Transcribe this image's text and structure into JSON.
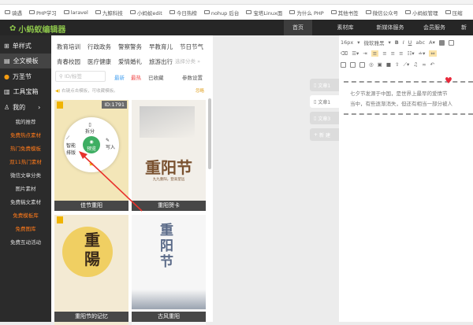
{
  "bookmarks": [
    "骑遇",
    "PHP学习",
    "laravel",
    "九鲸科技",
    "小蚂蚁edit",
    "今日热榜",
    "nohup 后台",
    "宝塔Linux面",
    "为什么 PHP",
    "其他书签",
    "微信公众号",
    "小蚂蚁管理",
    "压缩"
  ],
  "header": {
    "logo": "小蚂蚁编辑器",
    "nav": [
      "首页",
      "素材库",
      "新媒体服务",
      "会员服务",
      "新"
    ]
  },
  "sidebar": {
    "items": [
      "单样式",
      "全文模板",
      "万圣节",
      "工具宝箱",
      "我的"
    ],
    "sub": [
      {
        "label": "我的推荐",
        "color": "#dddddd"
      },
      {
        "label": "免费热点素材",
        "color": "#ff7a1a"
      },
      {
        "label": "热门免费模板",
        "color": "#ff7a1a"
      },
      {
        "label": "双11热门素材",
        "color": "#ff7a1a"
      },
      {
        "label": "微信文章分类",
        "color": "#dddddd"
      },
      {
        "label": "图片素材",
        "color": "#dddddd"
      },
      {
        "label": "免费稿文素材",
        "color": "#dddddd"
      },
      {
        "label": "免费模板库",
        "color": "#ff7a1a"
      },
      {
        "label": "免费图库",
        "color": "#ff7a1a"
      },
      {
        "label": "免费互动活动",
        "color": "#dddddd"
      }
    ]
  },
  "categories": {
    "row1": [
      "教育培训",
      "行政政务",
      "警察警务",
      "早教育儿",
      "节日节气"
    ],
    "row2": [
      "青春校园",
      "医疗健康",
      "爱情婚礼",
      "旅游出行"
    ],
    "more": "选择分类 »"
  },
  "filter": {
    "search_placeholder": "ID/标签",
    "newest": "最新",
    "hottest": "最热",
    "favorites": "已收藏",
    "settings": "参数设置"
  },
  "notice": {
    "text": "右键点击模板，可收藏模板。",
    "ignore": "忽略"
  },
  "cards": [
    {
      "label": "佳节重阳",
      "id": "ID:1791"
    },
    {
      "label": "重阳贺卡",
      "title": "重阳节",
      "subtitle": "九九重阳，登高望远"
    },
    {
      "label": "重阳节的记忆",
      "title": "重陽"
    },
    {
      "label": "古风重阳",
      "title": "重阳节"
    }
  ],
  "radial_menu": {
    "top": "拆分",
    "left": "智能排版",
    "right": "写入",
    "center": "预览"
  },
  "doc_tabs": [
    "文章1",
    "文章1",
    "文章3",
    "新 建"
  ],
  "toolbar": {
    "font_size": "16px",
    "font_family": "微软雅黑"
  },
  "editor": {
    "line1": "七夕节发源于中国，是世界上最早的爱情节",
    "line2": "当中，有些逐渐消失，但还有相当一部分被人"
  }
}
